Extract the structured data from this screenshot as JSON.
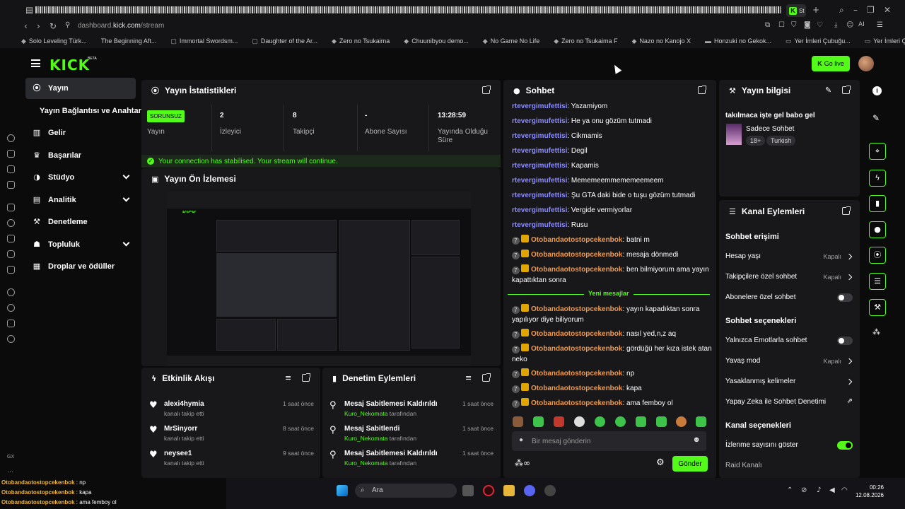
{
  "browser": {
    "url_prefix": "dashboard.",
    "url_domain": "kick.com",
    "url_path": "/stream",
    "active_tab_label": "St",
    "bookmarks": [
      "Solo Leveling Türk...",
      "The Beginning Aft...",
      "Immortal Swordsm...",
      "Daughter of the Ar...",
      "Zero no Tsukaima",
      "Chuunibyou demo...",
      "No Game No Life",
      "Zero no Tsukaima F",
      "Nazo no Kanojo X",
      "Honzuki no Gekok...",
      "Yer İmleri Çubuğu...",
      "Yer İmleri Çubuğu..."
    ]
  },
  "header": {
    "logo": "KICK",
    "beta": "BETA",
    "go_live": "Go live"
  },
  "nav": {
    "items": [
      {
        "label": "Yayın",
        "icon": "stream-icon"
      },
      {
        "label": "Yayın Bağlantısı ve Anahtarı"
      },
      {
        "label": "Gelir"
      },
      {
        "label": "Başarılar"
      },
      {
        "label": "Stüdyo"
      },
      {
        "label": "Analitik"
      },
      {
        "label": "Denetleme"
      },
      {
        "label": "Topluluk"
      },
      {
        "label": "Droplar ve ödüller"
      }
    ]
  },
  "stats": {
    "title": "Yayın İstatistikleri",
    "status_badge": "SORUNSUZ",
    "cols": [
      {
        "value": "",
        "label": "Yayın"
      },
      {
        "value": "2",
        "label": "İzleyici"
      },
      {
        "value": "8",
        "label": "Takipçi"
      },
      {
        "value": "-",
        "label": "Abone Sayısı"
      },
      {
        "value": "13:28:59",
        "label": "Yayında Olduğu Süre"
      }
    ],
    "notice": "Your connection has stabilised. Your stream will continue."
  },
  "preview": {
    "title": "Yayın Ön İzlemesi"
  },
  "activity": {
    "title": "Etkinlik Akışı",
    "items": [
      {
        "name": "alexi4hymia",
        "sub": "kanalı takip etti",
        "time": "1 saat önce"
      },
      {
        "name": "MrSinyorr",
        "sub": "kanalı takip etti",
        "time": "8 saat önce"
      },
      {
        "name": "neysee1",
        "sub": "kanalı takip etti",
        "time": "9 saat önce"
      }
    ]
  },
  "moderation": {
    "title": "Denetim Eylemleri",
    "items": [
      {
        "name": "Mesaj Sabitlemesi Kaldırıldı",
        "user": "Kuro_Nekomata",
        "by": "tarafından",
        "time": "1 saat önce"
      },
      {
        "name": "Mesaj Sabitlendi",
        "user": "Kuro_Nekomata",
        "by": "tarafından",
        "time": "1 saat önce"
      },
      {
        "name": "Mesaj Sabitlemesi Kaldırıldı",
        "user": "Kuro_Nekomata",
        "by": "tarafından",
        "time": "1 saat önce"
      }
    ]
  },
  "chat": {
    "title": "Sohbet",
    "messages_a": [
      {
        "user": "rtevergimufettisi",
        "text": ": Yazamiyom"
      },
      {
        "user": "rtevergimufettisi",
        "text": ": He ya onu gözüm tutmadi"
      },
      {
        "user": "rtevergimufettisi",
        "text": ": Cikmamis"
      },
      {
        "user": "rtevergimufettisi",
        "text": ": Degil"
      },
      {
        "user": "rtevergimufettisi",
        "text": ": Kapamis"
      },
      {
        "user": "rtevergimufettisi",
        "text": ": Mememeemmememeemeem"
      },
      {
        "user": "rtevergimufettisi",
        "text": ": Şu GTA daki bide o tuşu gözüm tutmadi"
      },
      {
        "user": "rtevergimufettisi",
        "text": ": Vergide vermiyorlar"
      },
      {
        "user": "rtevergimufettisi",
        "text": ": Rusu"
      }
    ],
    "messages_b": [
      {
        "user": "Otobandaotostopcekenbok",
        "text": ": batni m"
      },
      {
        "user": "Otobandaotostopcekenbok",
        "text": ": mesaja dönmedi"
      },
      {
        "user": "Otobandaotostopcekenbok",
        "text": ": ben bilmiyorum ama yayın kapattıktan sonra"
      }
    ],
    "new_messages": "Yeni mesajlar",
    "messages_c": [
      {
        "user": "Otobandaotostopcekenbok",
        "text": ": yayın kapadıktan sonra yapılıyor diye biliyorum"
      },
      {
        "user": "Otobandaotostopcekenbok",
        "text": ": nasıl yed,n,z aq"
      },
      {
        "user": "Otobandaotostopcekenbok",
        "text": ": gördüğü her kıza istek atan neko"
      },
      {
        "user": "Otobandaotostopcekenbok",
        "text": ": np"
      },
      {
        "user": "Otobandaotostopcekenbok",
        "text": ": kapa"
      },
      {
        "user": "Otobandaotostopcekenbok",
        "text": ": ama femboy ol"
      }
    ],
    "badge_num": "7",
    "placeholder": "Bir mesaj gönderin",
    "send": "Gönder"
  },
  "info": {
    "title": "Yayın bilgisi",
    "stream_title": "takılmaca işte gel babo gel",
    "category": "Sadece Sohbet",
    "tags": [
      "18+",
      "Turkish"
    ]
  },
  "channel": {
    "title": "Kanal Eylemleri",
    "sec1": "Sohbet erişimi",
    "acc_age": {
      "label": "Hesap yaşı",
      "value": "Kapalı"
    },
    "followers": {
      "label": "Takipçilere özel sohbet",
      "value": "Kapalı"
    },
    "subs": {
      "label": "Abonelere özel sohbet"
    },
    "sec2": "Sohbet seçenekleri",
    "emote": {
      "label": "Yalnızca Emotlarla sohbet"
    },
    "slow": {
      "label": "Yavaş mod",
      "value": "Kapalı"
    },
    "banned": {
      "label": "Yasaklanmış kelimeler"
    },
    "ai": {
      "label": "Yapay Zeka ile Sohbet Denetimi"
    },
    "sec3": "Kanal seçenekleri",
    "viewer_count": {
      "label": "İzlenme sayısını göster"
    },
    "raid": {
      "label": "Raid Kanalı"
    }
  },
  "ticker": [
    {
      "user": "Otobandaotostopcekenbok",
      "text": " : np"
    },
    {
      "user": "Otobandaotostopcekenbok",
      "text": " : kapa"
    },
    {
      "user": "Otobandaotostopcekenbok",
      "text": " : ama femboy ol"
    }
  ],
  "taskbar": {
    "search": "Ara",
    "time": "00:26",
    "date": "12.08.2026",
    "gx": "GX"
  }
}
